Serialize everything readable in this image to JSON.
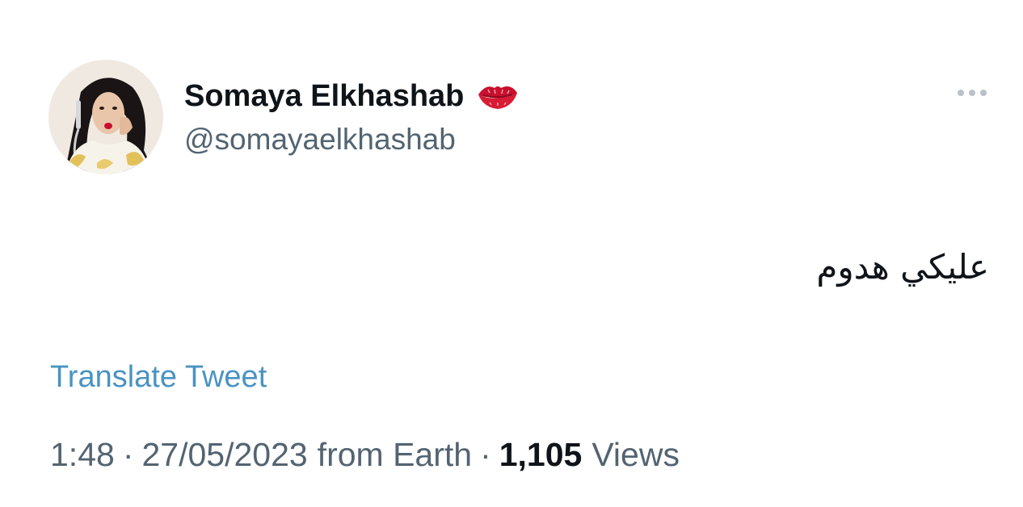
{
  "tweet": {
    "author": {
      "display_name": "Somaya Elkhashab",
      "handle": "@somayaelkhashab",
      "name_emoji_icon": "kiss-mark-icon",
      "avatar_icon": "profile-photo"
    },
    "more_icon": "more-dots-icon",
    "text": "عليكي هدوم",
    "translate_label": "Translate Tweet",
    "meta": {
      "time": "1:48",
      "separator": "·",
      "date": "27/05/2023",
      "source": "from Earth",
      "views_count": "1,105",
      "views_label": "Views"
    }
  },
  "colors": {
    "text_primary": "#0f1419",
    "text_secondary": "#536471",
    "link": "#4a93c2",
    "lips": "#c8102e"
  }
}
